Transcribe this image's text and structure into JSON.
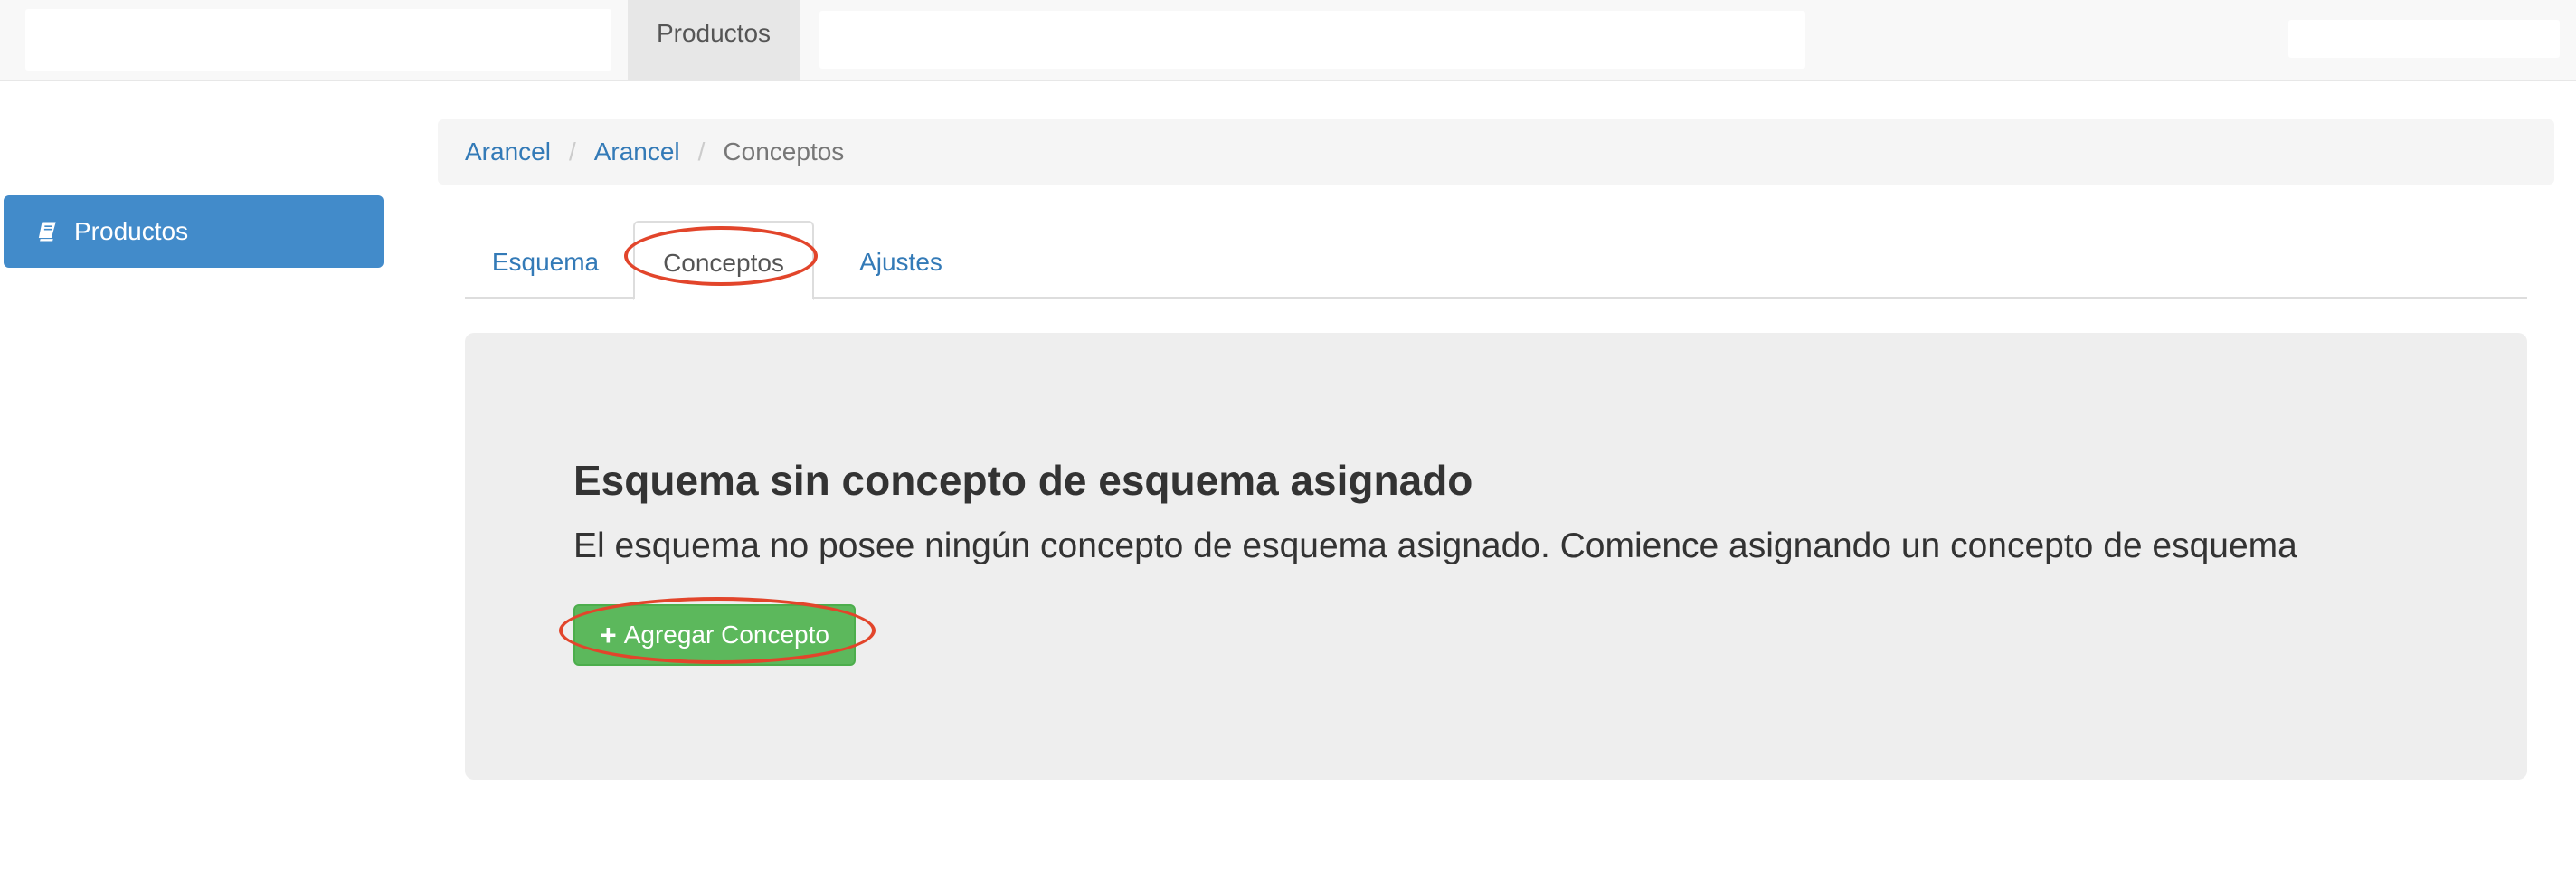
{
  "navbar": {
    "active_tab": "Productos"
  },
  "sidebar": {
    "items": [
      {
        "label": "Productos",
        "icon": "book-icon",
        "active": true
      }
    ]
  },
  "breadcrumb": {
    "items": [
      "Arancel",
      "Arancel",
      "Conceptos"
    ],
    "separator": "/"
  },
  "tabs": [
    {
      "label": "Esquema",
      "active": false
    },
    {
      "label": "Conceptos",
      "active": true
    },
    {
      "label": "Ajustes",
      "active": false
    }
  ],
  "panel": {
    "heading": "Esquema sin concepto de esquema asignado",
    "description": "El esquema no posee ningún concepto de esquema asignado. Comience asignando un concepto de esquema",
    "add_button_label": "Agregar Concepto",
    "add_button_icon": "plus-icon"
  },
  "colors": {
    "primary": "#428bca",
    "link": "#337ab7",
    "success": "#5cb85c",
    "annotation": "#e2452b"
  }
}
